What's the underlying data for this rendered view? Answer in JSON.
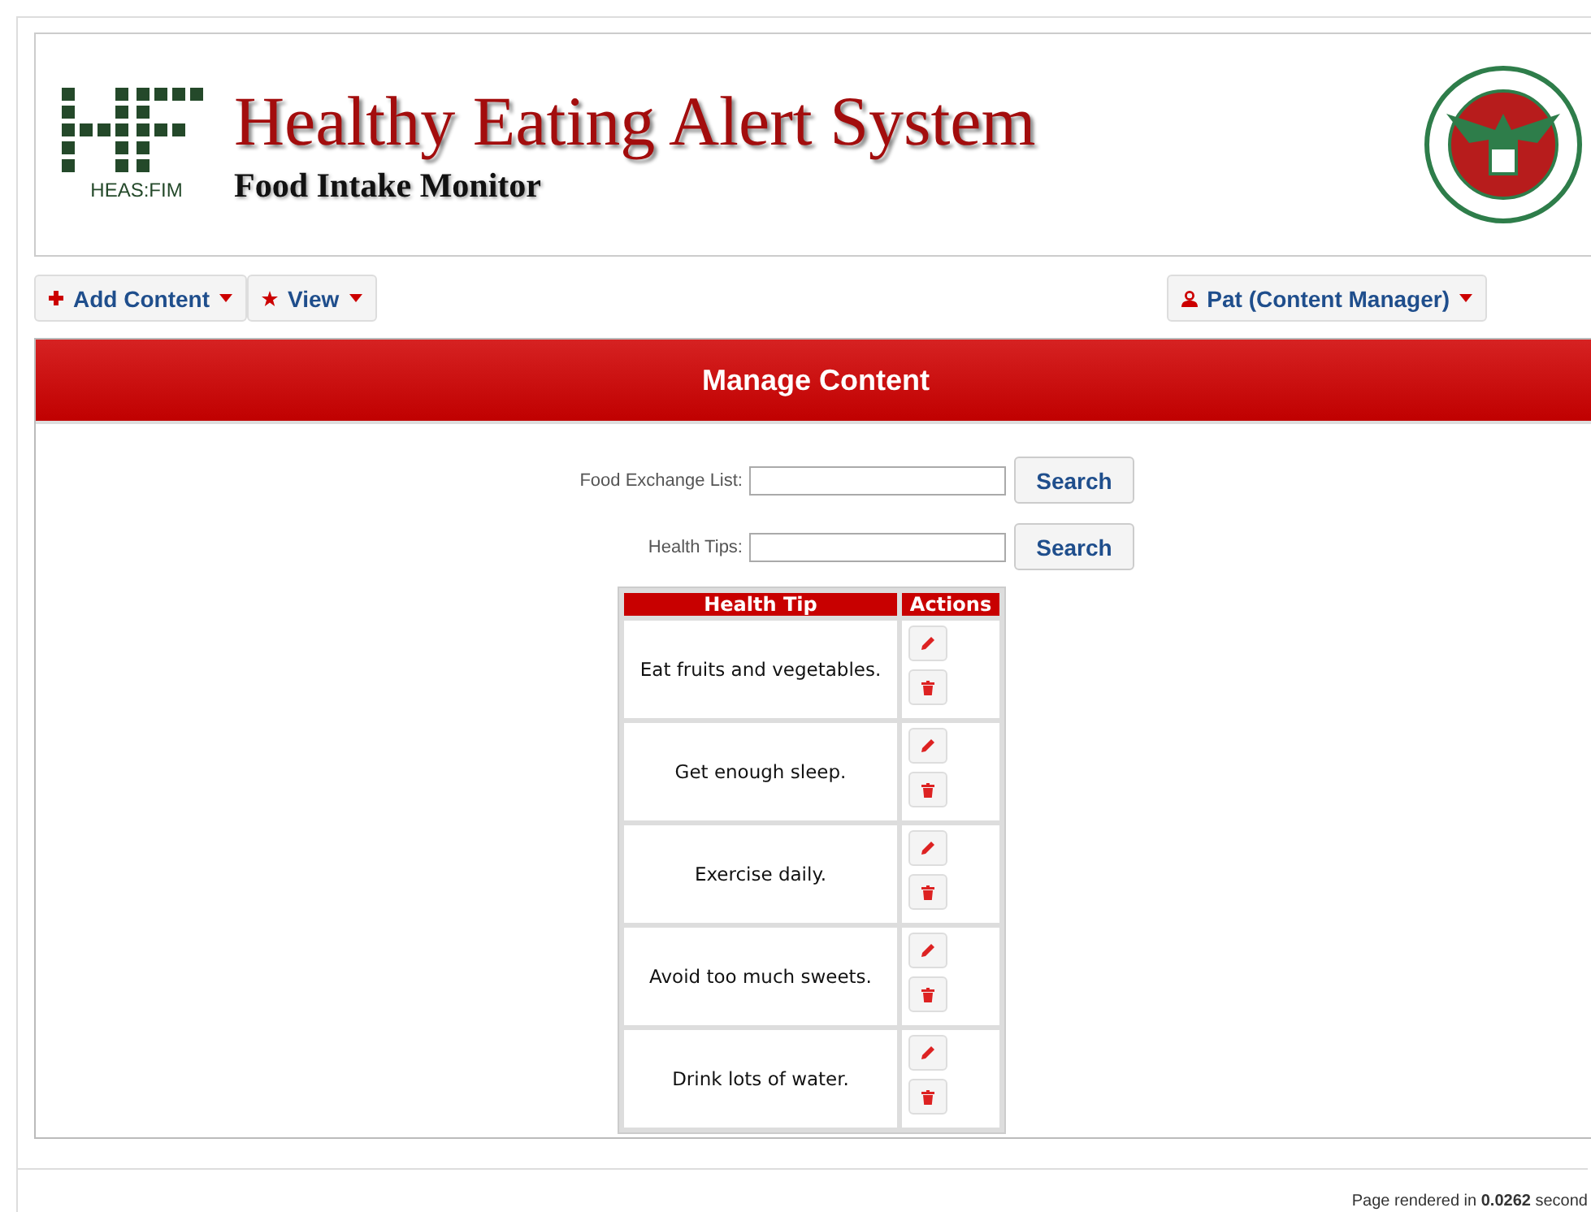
{
  "header": {
    "logo_text": "HEAS:FIM",
    "title": "Healthy Eating Alert System",
    "subtitle": "Food Intake Monitor"
  },
  "nav": {
    "left": [
      {
        "label": "Add Content"
      },
      {
        "label": "View"
      }
    ],
    "user": "Pat (Content Manager)"
  },
  "panel": {
    "title": "Manage Content",
    "searches": [
      {
        "label": "Food Exchange List:",
        "button": "Search"
      },
      {
        "label": "Health Tips:",
        "button": "Search"
      }
    ],
    "table": {
      "columns": [
        "Health Tip",
        "Actions"
      ],
      "rows": [
        "Eat fruits and vegetables.",
        "Get enough sleep.",
        "Exercise daily.",
        "Avoid too much sweets.",
        "Drink lots of water."
      ]
    }
  },
  "footer": "Page rendered in **0.0262** second"
}
